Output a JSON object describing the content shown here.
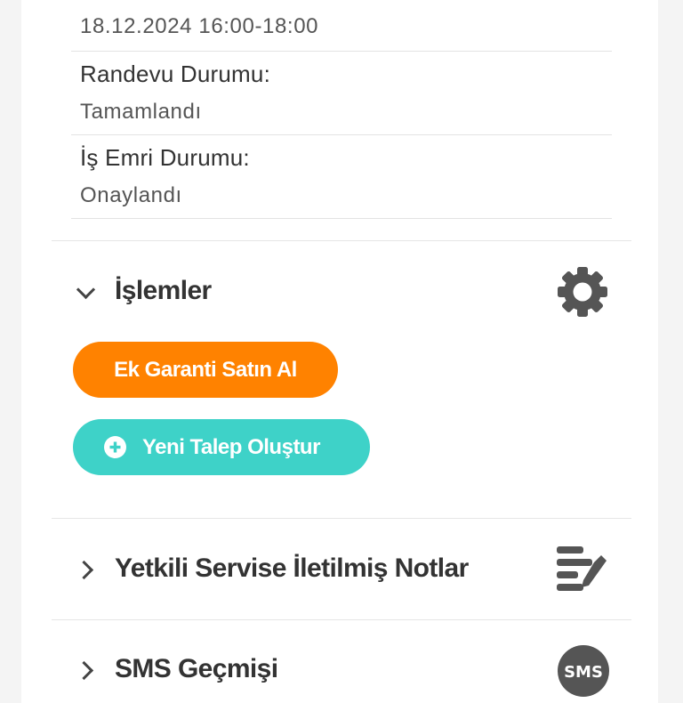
{
  "details": {
    "date_range": "18.12.2024 16:00-18:00",
    "appointment_status_label": "Randevu Durumu:",
    "appointment_status_value": "Tamamlandı",
    "work_order_status_label": "İş Emri Durumu:",
    "work_order_status_value": "Onaylandı"
  },
  "sections": {
    "operations": {
      "title": "İşlemler",
      "icon": "gear-icon",
      "buttons": {
        "extended_warranty": "Ek Garanti Satın Al",
        "new_request": "Yeni Talep Oluştur"
      }
    },
    "notes": {
      "title": "Yetkili Servise İletilmiş Notlar",
      "icon": "notes-edit-icon"
    },
    "sms": {
      "title": "SMS Geçmişi",
      "icon": "sms-icon",
      "icon_text": "SMS"
    }
  },
  "colors": {
    "orange": "#ff8200",
    "teal": "#3ed2c8",
    "text_dark": "#333333",
    "icon_gray": "#555555"
  }
}
